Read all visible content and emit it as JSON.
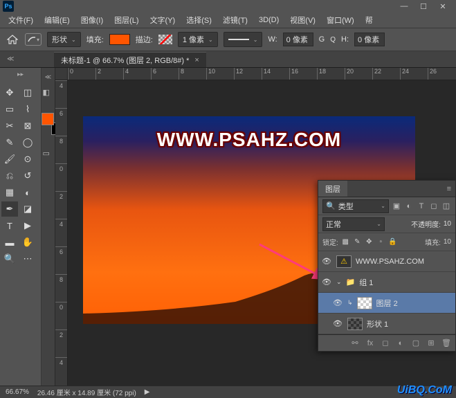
{
  "app": {
    "logo": "Ps"
  },
  "window": {
    "min": "—",
    "max": "☐",
    "close": "✕"
  },
  "menu": {
    "file": "文件(F)",
    "edit": "编辑(E)",
    "image": "图像(I)",
    "layer": "图层(L)",
    "type": "文字(Y)",
    "select": "选择(S)",
    "filter": "滤镜(T)",
    "threeD": "3D(D)",
    "view": "视图(V)",
    "window": "窗口(W)",
    "help": "帮"
  },
  "opt": {
    "shape": "形状",
    "fill_lbl": "填充:",
    "stroke_lbl": "描边:",
    "one_px": "1 像素",
    "w_lbl": "W:",
    "w_val": "0 像素",
    "link": "G",
    "h_lbl": "H:",
    "h_val": "0 像素"
  },
  "tab": {
    "title": "未标题-1 @ 66.7% (图层 2, RGB/8#) *",
    "close": "×"
  },
  "ruler_h": [
    "0",
    "2",
    "4",
    "6",
    "8",
    "10",
    "12",
    "14",
    "16",
    "18",
    "20",
    "22",
    "24",
    "26"
  ],
  "ruler_v": [
    "4",
    "6",
    "8",
    "0",
    "2",
    "4",
    "6",
    "8",
    "0",
    "2",
    "4"
  ],
  "canvas": {
    "watermark": "WWW.PSAHZ.COM"
  },
  "layers": {
    "title": "图层",
    "filter": "类型",
    "blend": "正常",
    "opacity_lbl": "不透明度:",
    "opacity_val": "10",
    "lock_lbl": "锁定:",
    "fill_lbl": "填充:",
    "fill_val": "10",
    "items": [
      {
        "name": "WWW.PSAHZ.COM"
      },
      {
        "name": "组 1"
      },
      {
        "name": "图层 2"
      },
      {
        "name": "形状 1"
      }
    ]
  },
  "status": {
    "zoom": "66.67%",
    "dims": "26.46 厘米 x 14.89 厘米 (72 ppi)",
    "arrow": "▶"
  },
  "corner": "UiBQ.CoM"
}
